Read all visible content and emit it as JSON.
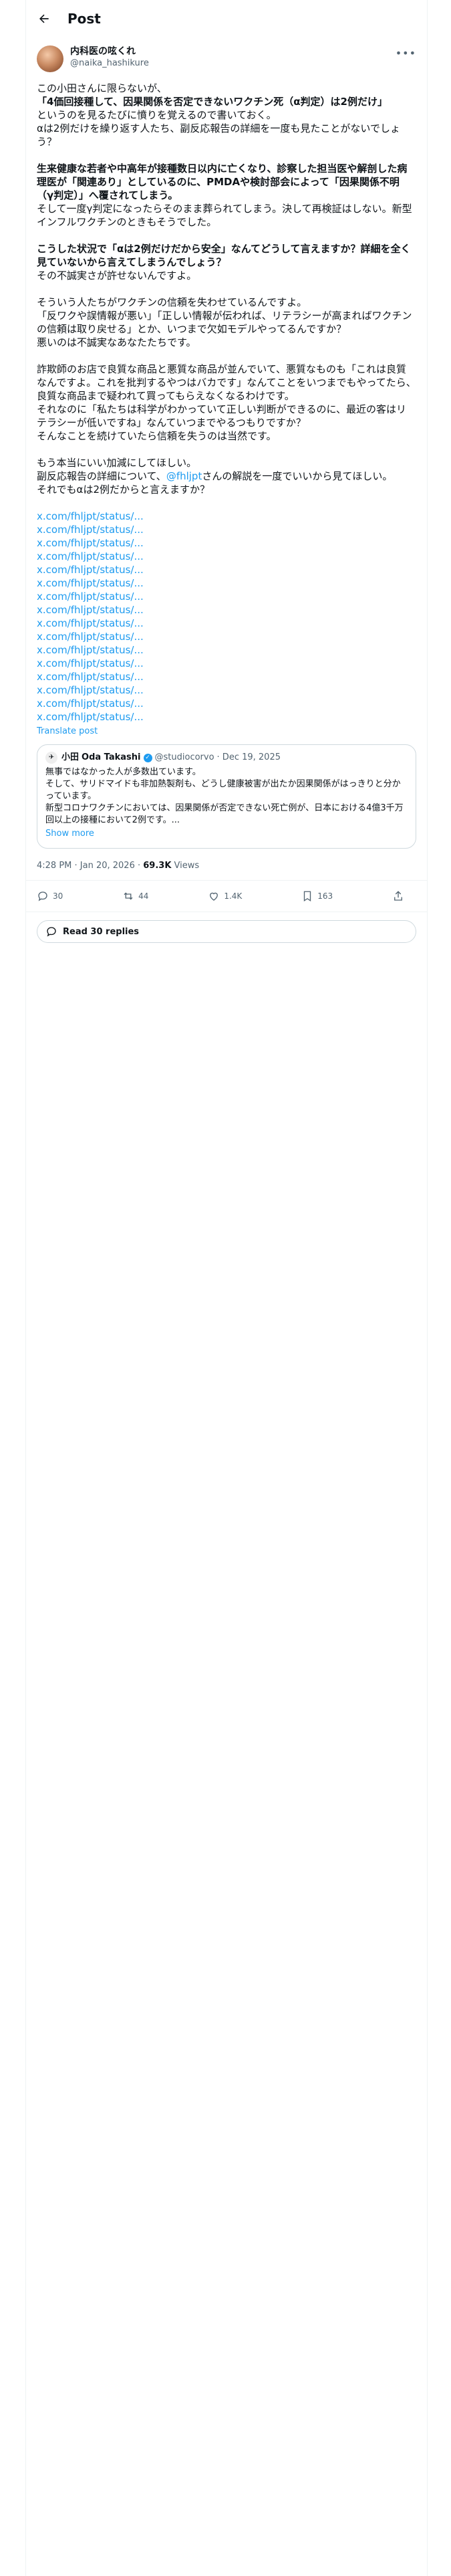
{
  "header": {
    "title": "Post"
  },
  "author": {
    "name": "内科医の呟くれ",
    "handle": "@naika_hashikure"
  },
  "body": {
    "p1": [
      {
        "text": "この小田さんに限らないが、",
        "bold": false
      },
      {
        "text": "「4価回接種して、因果関係を否定できないワクチン死（α判定）は2例だけ」",
        "bold": true
      },
      {
        "text": "というのを見るたびに憤りを覚えるので書いておく。",
        "bold": false
      },
      {
        "text": "αは2例だけを繰り返す人たち、副反応報告の詳細を一度も見たことがないでしょう？",
        "bold": false
      }
    ],
    "p2": [
      {
        "text": "生来健康な若者や中高年が接種数日以内に亡くなり、診察した担当医や解剖した病理医が「関連あり」としているのに、PMDAや検討部会によって「因果関係不明（γ判定）」へ覆されてしまう。",
        "bold": true
      },
      {
        "text": "そして一度γ判定になったらそのまま葬られてしまう。決して再検証はしない。新型インフルワクチンのときもそうでした。",
        "bold": false
      }
    ],
    "p3": [
      {
        "text": "こうした状況で「αは2例だけだから安全」なんてどうして言えますか？詳細を全く見ていないから言えてしまうんでしょう？",
        "bold": true
      },
      {
        "text": "その不誠実さが許せないんですよ。",
        "bold": false
      }
    ],
    "p4": [
      {
        "text": "そういう人たちがワクチンの信頼を失わせているんですよ。",
        "bold": false
      },
      {
        "text": "「反ワクや誤情報が悪い」「正しい情報が伝われば、リテラシーが高まればワクチンの信頼は取り戻せる」とか、いつまで欠如モデルやってるんですか？",
        "bold": false
      },
      {
        "text": "悪いのは不誠実なあなたたちです。",
        "bold": false
      }
    ],
    "p5": [
      {
        "text": "詐欺師のお店で良質な商品と悪質な商品が並んでいて、悪質なものも「これは良質なんですよ。これを批判するやつはバカです」なんてことをいつまでもやってたら、良質な商品まで疑われて買ってもらえなくなるわけです。",
        "bold": false
      },
      {
        "text": "それなのに「私たちは科学がわかっていて正しい判断ができるのに、最近の客はリテラシーが低いですね」なんていつまでやるつもりですか？",
        "bold": false
      },
      {
        "text": "そんなことを続けていたら信頼を失うのは当然です。",
        "bold": false
      }
    ],
    "p6_line1": "もう本当にいい加減にしてほしい。",
    "p6_line2_pre": "副反応報告の詳細について、",
    "p6_mention": "@fhljpt",
    "p6_line2_post": "さんの解説を一度でいいから見てほしい。",
    "p6_line3": "それでもαは2例だからと言えますか？"
  },
  "links": [
    "x.com/fhljpt/status/...",
    "x.com/fhljpt/status/...",
    "x.com/fhljpt/status/...",
    "x.com/fhljpt/status/...",
    "x.com/fhljpt/status/...",
    "x.com/fhljpt/status/...",
    "x.com/fhljpt/status/...",
    "x.com/fhljpt/status/...",
    "x.com/fhljpt/status/...",
    "x.com/fhljpt/status/...",
    "x.com/fhljpt/status/...",
    "x.com/fhljpt/status/...",
    "x.com/fhljpt/status/...",
    "x.com/fhljpt/status/...",
    "x.com/fhljpt/status/...",
    "x.com/fhljpt/status/..."
  ],
  "translate": "Translate post",
  "quote": {
    "avatar_text": "小田",
    "name": "Oda Takashi",
    "handle": "@studiocorvo",
    "date": "· Dec 19, 2025",
    "lines": [
      "無事ではなかった人が多数出ています。",
      "そして、サリドマイドも非加熱製剤も、どうし健康被害が出たか因果関係がはっきりと分かっています。",
      "新型コロナワクチンにおいては、因果関係が否定できない死亡例が、日本における4億3千万回以上の接種において2例です。..."
    ],
    "show_more": "Show more"
  },
  "meta": {
    "time": "4:28 PM · Jan 20, 2026 · ",
    "views": "69.3K",
    "views_label": " Views"
  },
  "actions": {
    "replies": "30",
    "reposts": "44",
    "likes": "1.4K",
    "bookmarks": "163"
  },
  "read_replies": "Read 30 replies"
}
